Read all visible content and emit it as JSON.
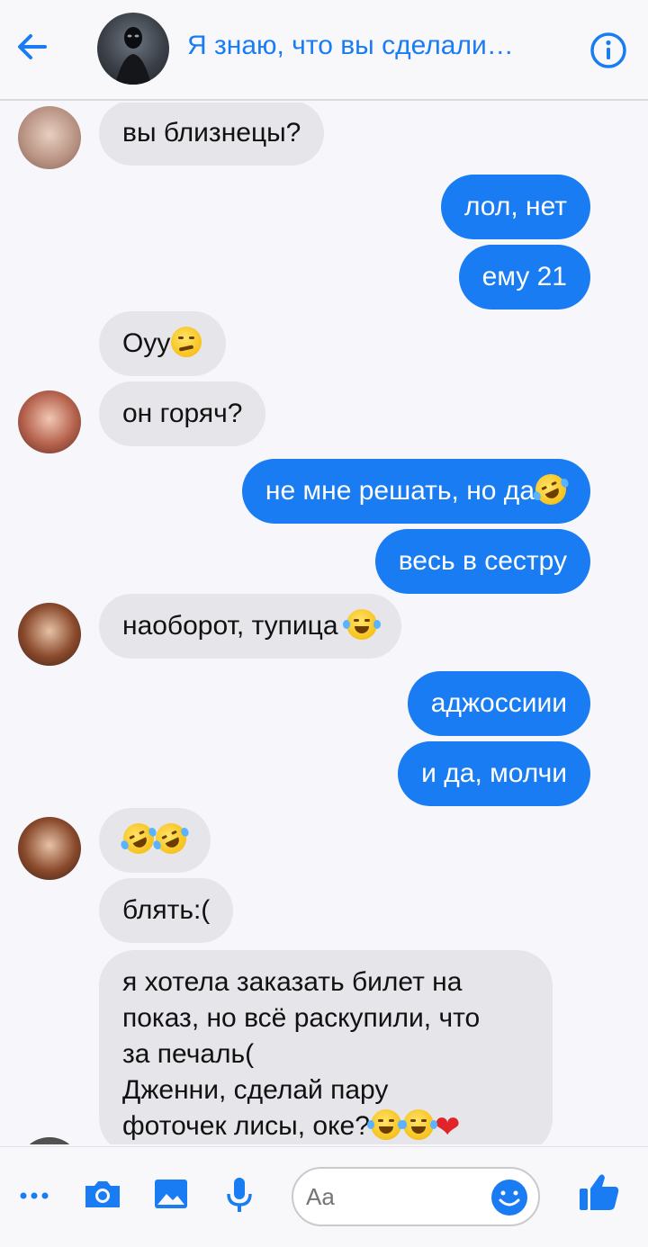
{
  "header": {
    "title": "Я знаю, что вы сделали…",
    "back_icon": "arrow-left-icon",
    "info_icon": "info-icon"
  },
  "messages": [
    {
      "dir": "in",
      "text": "вы близнецы?"
    },
    {
      "dir": "out",
      "text": "лол, нет"
    },
    {
      "dir": "out",
      "text": "ему 21"
    },
    {
      "dir": "in",
      "text": "Оуу",
      "emoji": "smirk"
    },
    {
      "dir": "in",
      "text": "он горяч?"
    },
    {
      "dir": "out",
      "text": "не мне решать, но да",
      "emoji": "rofl"
    },
    {
      "dir": "out",
      "text": "весь в сестру"
    },
    {
      "dir": "in",
      "text": "наоборот, тупица",
      "emoji": "joy"
    },
    {
      "dir": "out",
      "text": "аджоссиии"
    },
    {
      "dir": "out",
      "text": "и да, молчи"
    },
    {
      "dir": "in",
      "text": "",
      "emoji": "rofl rofl"
    },
    {
      "dir": "in",
      "text": "блять:("
    },
    {
      "dir": "in",
      "lines": [
        "я хотела заказать билет на",
        "показ, но всё раскупили, что",
        "за печаль(",
        "Дженни, сделай пару",
        "фоточек лисы, оке?"
      ],
      "emoji": "joy joy heart"
    }
  ],
  "composer": {
    "placeholder": "Aa"
  },
  "colors": {
    "accent": "#1a7cf2",
    "incoming_bubble": "#e5e5ea",
    "background": "#f6f6fb"
  },
  "icons": [
    "more-icon",
    "camera-icon",
    "image-icon",
    "microphone-icon",
    "emoji-icon",
    "thumbs-up-icon"
  ]
}
